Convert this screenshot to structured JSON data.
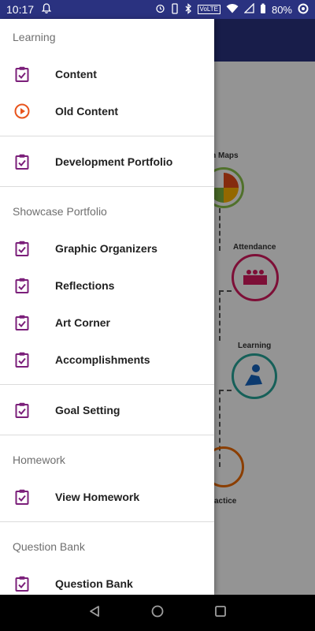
{
  "status_bar": {
    "time": "10:17",
    "network_badge": "VoLTE",
    "battery": "80%",
    "icons": [
      "notification-bell-icon",
      "alarm-icon",
      "vibrate-icon",
      "bluetooth-icon",
      "wifi-icon",
      "signal-icon",
      "battery-icon",
      "sync-icon"
    ]
  },
  "background": {
    "label_1": "on Maps",
    "label_2": "Attendance",
    "label_3": "Learning",
    "label_4": "actice"
  },
  "drawer": {
    "sections": [
      {
        "header": "Learning",
        "items": [
          {
            "label": "Content",
            "icon": "clipboard-check-icon"
          },
          {
            "label": "Old Content",
            "icon": "play-circle-icon"
          }
        ]
      },
      {
        "header": "",
        "items": [
          {
            "label": "Development Portfolio",
            "icon": "clipboard-check-icon"
          }
        ]
      },
      {
        "header": "Showcase Portfolio",
        "items": [
          {
            "label": "Graphic Organizers",
            "icon": "clipboard-check-icon"
          },
          {
            "label": "Reflections",
            "icon": "clipboard-check-icon"
          },
          {
            "label": "Art Corner",
            "icon": "clipboard-check-icon"
          },
          {
            "label": "Accomplishments",
            "icon": "clipboard-check-icon"
          }
        ]
      },
      {
        "header": "",
        "items": [
          {
            "label": "Goal Setting",
            "icon": "clipboard-check-icon"
          }
        ]
      },
      {
        "header": "Homework",
        "items": [
          {
            "label": "View Homework",
            "icon": "clipboard-check-icon"
          }
        ]
      },
      {
        "header": "Question Bank",
        "items": [
          {
            "label": "Question Bank",
            "icon": "clipboard-check-icon"
          }
        ]
      }
    ]
  },
  "colors": {
    "primary": "#2a3280",
    "icon_purple": "#7b1f7a",
    "icon_orange": "#e8541c"
  },
  "system_nav": {
    "buttons": [
      "back-icon",
      "home-icon",
      "recents-icon"
    ]
  }
}
